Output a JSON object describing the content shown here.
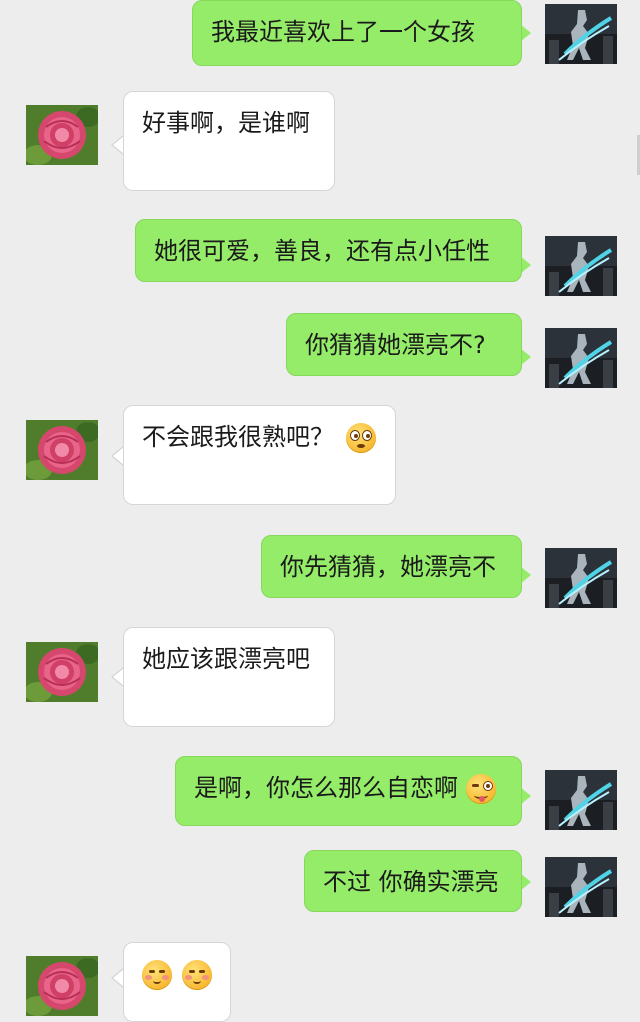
{
  "chat": {
    "messages": [
      {
        "side": "me",
        "text": "我最近喜欢上了一个女孩"
      },
      {
        "side": "them",
        "text": "好事啊，是谁啊"
      },
      {
        "side": "me",
        "text": "她很可爱，善良，还有点小任性"
      },
      {
        "side": "me",
        "text": "你猜猜她漂亮不?"
      },
      {
        "side": "them",
        "text": "不会跟我很熟吧？",
        "emoji": "flushed-face"
      },
      {
        "side": "me",
        "text": "你先猜猜，她漂亮不"
      },
      {
        "side": "them",
        "text": "她应该跟漂亮吧"
      },
      {
        "side": "me",
        "text": "是啊，你怎么那么自恋啊",
        "emoji": "winking-tongue-face"
      },
      {
        "side": "me",
        "text": "不过 你确实漂亮"
      },
      {
        "side": "them",
        "text": "",
        "emoji": "blushing-face x2"
      }
    ]
  },
  "colors": {
    "background": "#ededed",
    "my_bubble": "#95ec69",
    "their_bubble": "#ffffff"
  },
  "icons": {
    "my_avatar": "armored-hero-avatar-icon",
    "their_avatar": "pink-rose-avatar-icon"
  }
}
